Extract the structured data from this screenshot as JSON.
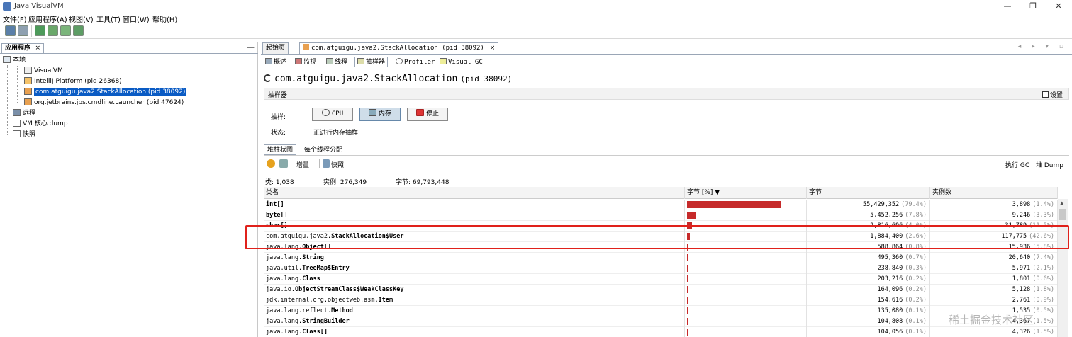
{
  "window": {
    "title": "Java VisualVM",
    "controls": [
      "—",
      "❐",
      "✕"
    ]
  },
  "menu": [
    "文件(F)",
    "应用程序(A)",
    "视图(V)",
    "工具(T)",
    "窗口(W)",
    "帮助(H)"
  ],
  "left_panel": {
    "tab_label": "应用程序",
    "close": "×",
    "minimize": "—",
    "tree": [
      {
        "label": "本地",
        "level": 0
      },
      {
        "label": "VisualVM",
        "level": 1
      },
      {
        "label": "IntelliJ Platform (pid 26368)",
        "level": 1
      },
      {
        "label": "com.atguigu.java2.StackAllocation (pid 38092)",
        "level": 1,
        "selected": true
      },
      {
        "label": "org.jetbrains.jps.cmdline.Launcher (pid 47624)",
        "level": 1
      },
      {
        "label": "远程",
        "level": 0
      },
      {
        "label": "VM 核心 dump",
        "level": 0
      },
      {
        "label": "快照",
        "level": 0
      }
    ]
  },
  "doc_tabs": {
    "start": "起始页",
    "process": "com.atguigu.java2.StackAllocation (pid 38092)",
    "close": "×",
    "nav": "◂ ▸ ▾ ▫"
  },
  "sub_tabs": [
    "概述",
    "监视",
    "线程",
    "抽样器",
    "Profiler",
    "Visual GC"
  ],
  "process_title": {
    "name": "com.atguigu.java2.StackAllocation",
    "pid": "(pid 38092)"
  },
  "sampler": {
    "section_label": "抽样器",
    "settings_label": "设置",
    "sample_label": "抽样:",
    "buttons": [
      "CPU",
      "内存",
      "停止"
    ],
    "state_label": "状态:",
    "state_value": "正进行内存抽样"
  },
  "view_tabs": [
    "堆柱状图",
    "每个线程分配"
  ],
  "result_tools": {
    "delta": "增量",
    "snapshot": "快照",
    "gc": "执行 GC",
    "heap_dump": "堆 Dump"
  },
  "stats": {
    "classes": "类: 1,038",
    "instances": "实例: 276,349",
    "bytes": "字节: 69,793,448"
  },
  "table": {
    "headers": [
      "类名",
      "字节 [%] ▼",
      "字节",
      "实例数"
    ],
    "rows": [
      {
        "name_prefix": "",
        "name_bold": "int[]",
        "pct_bar": 79.4,
        "bytes": "55,429,352",
        "bytes_pct": "(79.4%)",
        "inst": "3,898",
        "inst_pct": "(1.4%)"
      },
      {
        "name_prefix": "",
        "name_bold": "byte[]",
        "pct_bar": 7.8,
        "bytes": "5,452,256",
        "bytes_pct": "(7.8%)",
        "inst": "9,246",
        "inst_pct": "(3.3%)"
      },
      {
        "name_prefix": "",
        "name_bold": "char[]",
        "pct_bar": 4.0,
        "bytes": "2,816,696",
        "bytes_pct": "(4.0%)",
        "inst": "31,789",
        "inst_pct": "(11.5%)"
      },
      {
        "name_prefix": "com.atguigu.java2.",
        "name_bold": "StackAllocation$User",
        "pct_bar": 2.6,
        "bytes": "1,884,400",
        "bytes_pct": "(2.6%)",
        "inst": "117,775",
        "inst_pct": "(42.6%)"
      },
      {
        "name_prefix": "java.lang.",
        "name_bold": "Object[]",
        "pct_bar": 0.8,
        "bytes": "588,864",
        "bytes_pct": "(0.8%)",
        "inst": "15,936",
        "inst_pct": "(5.8%)"
      },
      {
        "name_prefix": "java.lang.",
        "name_bold": "String",
        "pct_bar": 0.7,
        "bytes": "495,360",
        "bytes_pct": "(0.7%)",
        "inst": "20,640",
        "inst_pct": "(7.4%)"
      },
      {
        "name_prefix": "java.util.",
        "name_bold": "TreeMap$Entry",
        "pct_bar": 0.3,
        "bytes": "238,840",
        "bytes_pct": "(0.3%)",
        "inst": "5,971",
        "inst_pct": "(2.1%)"
      },
      {
        "name_prefix": "java.lang.",
        "name_bold": "Class",
        "pct_bar": 0.2,
        "bytes": "203,216",
        "bytes_pct": "(0.2%)",
        "inst": "1,801",
        "inst_pct": "(0.6%)"
      },
      {
        "name_prefix": "java.io.",
        "name_bold": "ObjectStreamClass$WeakClassKey",
        "pct_bar": 0.2,
        "bytes": "164,096",
        "bytes_pct": "(0.2%)",
        "inst": "5,128",
        "inst_pct": "(1.8%)"
      },
      {
        "name_prefix": "jdk.internal.org.objectweb.asm.",
        "name_bold": "Item",
        "pct_bar": 0.2,
        "bytes": "154,616",
        "bytes_pct": "(0.2%)",
        "inst": "2,761",
        "inst_pct": "(0.9%)"
      },
      {
        "name_prefix": "java.lang.reflect.",
        "name_bold": "Method",
        "pct_bar": 0.1,
        "bytes": "135,080",
        "bytes_pct": "(0.1%)",
        "inst": "1,535",
        "inst_pct": "(0.5%)"
      },
      {
        "name_prefix": "java.lang.",
        "name_bold": "StringBuilder",
        "pct_bar": 0.1,
        "bytes": "104,808",
        "bytes_pct": "(0.1%)",
        "inst": "4,367",
        "inst_pct": "(1.5%)"
      },
      {
        "name_prefix": "java.lang.",
        "name_bold": "Class[]",
        "pct_bar": 0.1,
        "bytes": "104,056",
        "bytes_pct": "(0.1%)",
        "inst": "4,326",
        "inst_pct": "(1.5%)"
      }
    ]
  },
  "watermark": "稀土掘金技术社区",
  "colors": {
    "bar": "#c62a2a",
    "highlight": "#e0211b",
    "selection": "#0a5bc4"
  }
}
